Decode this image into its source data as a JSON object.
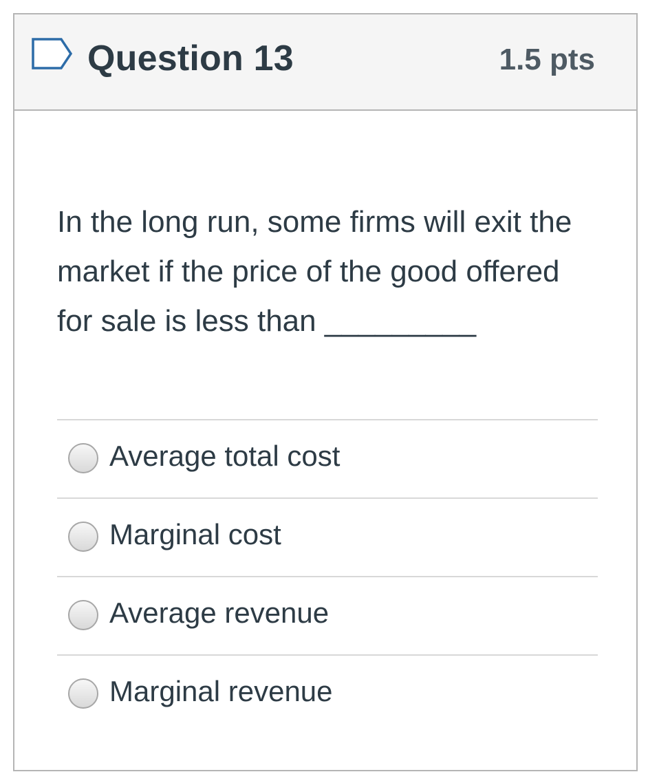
{
  "question": {
    "title": "Question 13",
    "points": "1.5 pts",
    "flag_icon": "bookmark-flag-icon",
    "text": "In the long run, some firms will exit the market if the price of the good offered for sale is less than _________"
  },
  "answers": [
    {
      "label": "Average total cost",
      "selected": false
    },
    {
      "label": "Marginal cost",
      "selected": false
    },
    {
      "label": "Average revenue",
      "selected": false
    },
    {
      "label": "Marginal revenue",
      "selected": false
    }
  ],
  "colors": {
    "header_bg": "#f5f5f5",
    "border": "#b5b5b5",
    "text": "#2d3b45",
    "flag": "#2d6ca8"
  }
}
